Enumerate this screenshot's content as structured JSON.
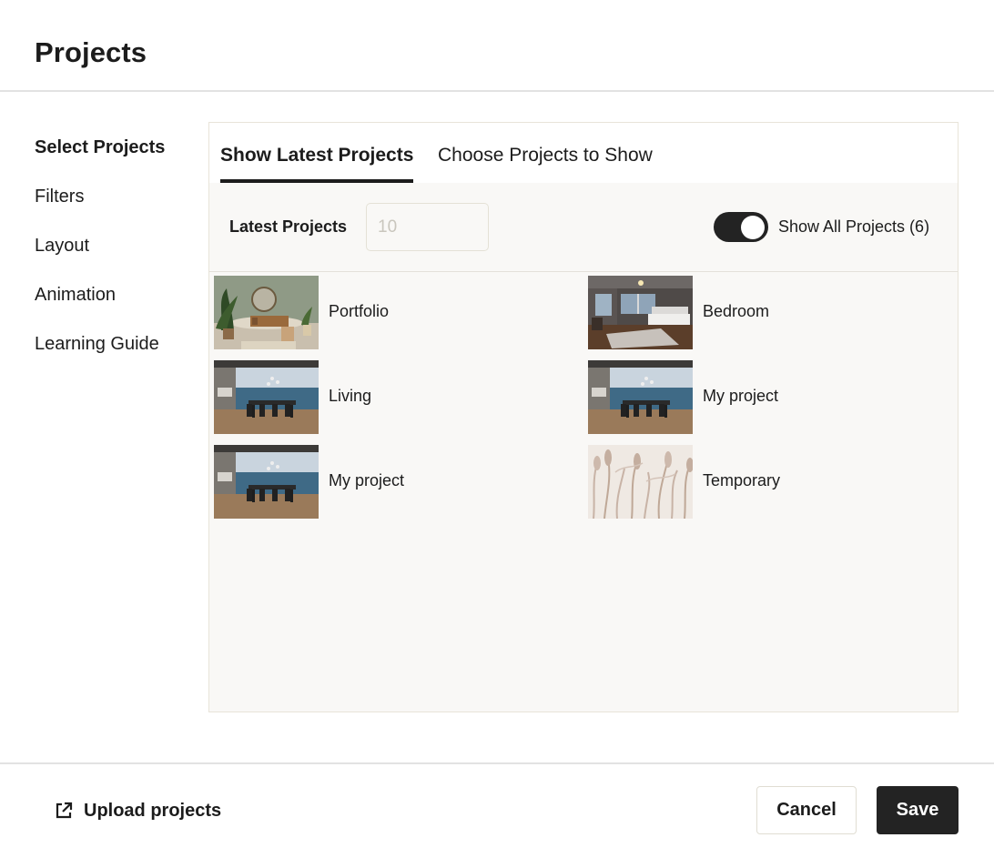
{
  "header": {
    "title": "Projects"
  },
  "sidebar": {
    "items": [
      {
        "label": "Select Projects",
        "active": true
      },
      {
        "label": "Filters"
      },
      {
        "label": "Layout"
      },
      {
        "label": "Animation"
      },
      {
        "label": "Learning Guide"
      }
    ]
  },
  "tabs": [
    {
      "label": "Show Latest Projects",
      "active": true
    },
    {
      "label": "Choose Projects to Show"
    }
  ],
  "controls": {
    "latest_label": "Latest Projects",
    "latest_placeholder": "10",
    "toggle_on": true,
    "toggle_label": "Show All Projects (6)"
  },
  "projects": [
    {
      "name": "Portfolio",
      "thumb": "living-plants"
    },
    {
      "name": "Bedroom",
      "thumb": "bedroom"
    },
    {
      "name": "Living",
      "thumb": "dining-sea"
    },
    {
      "name": "My project",
      "thumb": "dining-sea"
    },
    {
      "name": "My project",
      "thumb": "dining-sea"
    },
    {
      "name": "Temporary",
      "thumb": "grass-pattern"
    }
  ],
  "footer": {
    "upload_label": "Upload projects",
    "upload_icon": "external-link-icon",
    "cancel_label": "Cancel",
    "save_label": "Save"
  },
  "colors": {
    "primary": "#232323",
    "panel_bg": "#f9f8f6",
    "border": "#e8e4d9"
  }
}
